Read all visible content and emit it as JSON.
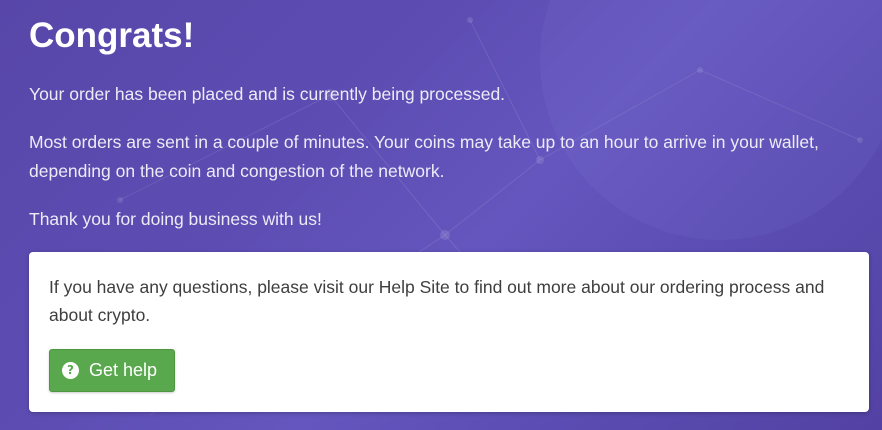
{
  "confirmation": {
    "title": "Congrats!",
    "paragraphs": [
      "Your order has been placed and is currently being processed.",
      "Most orders are sent in a couple of minutes. Your coins may take up to an hour to arrive in your wallet, depending on the coin and congestion of the network.",
      "Thank you for doing business with us!"
    ]
  },
  "help_card": {
    "text": "If you have any questions, please visit our Help Site to find out more about our ordering process and about crypto.",
    "button_label": "Get help",
    "button_icon": "question-circle-icon",
    "button_color": "#5aa84d"
  },
  "colors": {
    "background": "#5d4db3",
    "card": "#ffffff"
  }
}
